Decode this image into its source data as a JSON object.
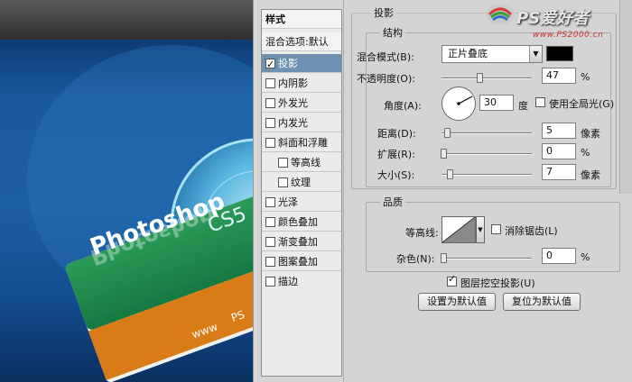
{
  "watermark": {
    "logo_text": "PS爱好者",
    "url": "www.PS2000.cn"
  },
  "canvas": {
    "card_title": "Photoshop",
    "card_title_mirror": "Photoshop",
    "disc_label": "CS5",
    "card_footer": "www",
    "disc_footer": "PS"
  },
  "styles": {
    "header": "样式",
    "blend_options": "混合选项:默认",
    "items": [
      {
        "label": "投影",
        "checked": true,
        "selected": true
      },
      {
        "label": "内阴影",
        "checked": false
      },
      {
        "label": "外发光",
        "checked": false
      },
      {
        "label": "内发光",
        "checked": false
      },
      {
        "label": "斜面和浮雕",
        "checked": false
      },
      {
        "label": "等高线",
        "checked": false,
        "sub": true
      },
      {
        "label": "纹理",
        "checked": false,
        "sub": true
      },
      {
        "label": "光泽",
        "checked": false
      },
      {
        "label": "颜色叠加",
        "checked": false
      },
      {
        "label": "渐变叠加",
        "checked": false
      },
      {
        "label": "图案叠加",
        "checked": false
      },
      {
        "label": "描边",
        "checked": false
      }
    ]
  },
  "drop_shadow": {
    "title": "投影",
    "structure": {
      "title": "结构",
      "blend_mode_label": "混合模式(B):",
      "blend_mode_value": "正片叠底",
      "swatch_color": "#000000",
      "opacity_label": "不透明度(O):",
      "opacity_value": "47",
      "opacity_unit": "%",
      "opacity_fraction": 0.47,
      "angle_label": "角度(A):",
      "angle_value": "30",
      "angle_unit": "度",
      "global_light_label": "使用全局光(G)",
      "global_light_checked": false,
      "distance_label": "距离(D):",
      "distance_value": "5",
      "distance_unit": "像素",
      "spread_label": "扩展(R):",
      "spread_value": "0",
      "spread_unit": "%",
      "size_label": "大小(S):",
      "size_value": "7",
      "size_unit": "像素"
    },
    "quality": {
      "title": "品质",
      "contour_label": "等高线:",
      "anti_alias_label": "消除锯齿(L)",
      "anti_alias_checked": false,
      "noise_label": "杂色(N):",
      "noise_value": "0",
      "noise_unit": "%"
    },
    "layer_knockout_label": "图层挖空投影(U)",
    "layer_knockout_checked": true,
    "make_default_label": "设置为默认值",
    "reset_default_label": "复位为默认值"
  }
}
